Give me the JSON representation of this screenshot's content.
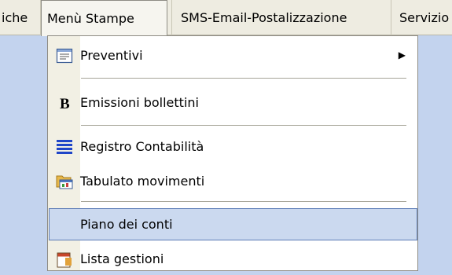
{
  "menubar": {
    "items": [
      {
        "label": "iche"
      },
      {
        "label": "Menù Stampe"
      },
      {
        "label": "SMS-Email-Postalizzazione"
      },
      {
        "label": "Servizio"
      }
    ]
  },
  "menu": {
    "items": [
      {
        "label": "Preventivi",
        "icon": "document-icon",
        "submenu_arrow": "▶"
      },
      {
        "label": "Emissioni bollettini",
        "icon": "bold-b-icon"
      },
      {
        "label": "Registro Contabilità",
        "icon": "list-lines-icon"
      },
      {
        "label": "Tabulato movimenti",
        "icon": "folder-chart-icon"
      },
      {
        "label": "Piano dei conti",
        "icon": ""
      },
      {
        "label": "Lista gestioni",
        "icon": "report-icon"
      }
    ]
  },
  "colors": {
    "menubar_bg": "#eeece1",
    "desktop_bg": "#c3d3ee",
    "highlight_bg": "#cbd9ef",
    "highlight_border": "#5b7bb6"
  }
}
